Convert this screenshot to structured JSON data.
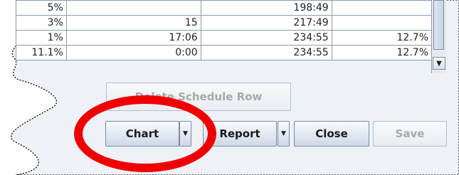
{
  "table": {
    "rows": [
      [
        "5%",
        "",
        "198:49",
        ""
      ],
      [
        "3%",
        "15",
        "217:49",
        ""
      ],
      [
        "1%",
        "17:06",
        "234:55",
        "12.7%"
      ],
      [
        "11.1%",
        "0:00",
        "234:55",
        "12.7%"
      ]
    ]
  },
  "scrollbar": {
    "down_arrow": "▼"
  },
  "buttons": {
    "delete_schedule_row": "Delete Schedule Row",
    "chart": "Chart",
    "report": "Report",
    "close": "Close",
    "save": "Save",
    "dropdown_arrow": "▼"
  },
  "colors": {
    "annotation": "#ee0000",
    "button_border": "#7a8aa3",
    "disabled_text": "#a9a9a9",
    "panel_background": "#eef2f6"
  }
}
